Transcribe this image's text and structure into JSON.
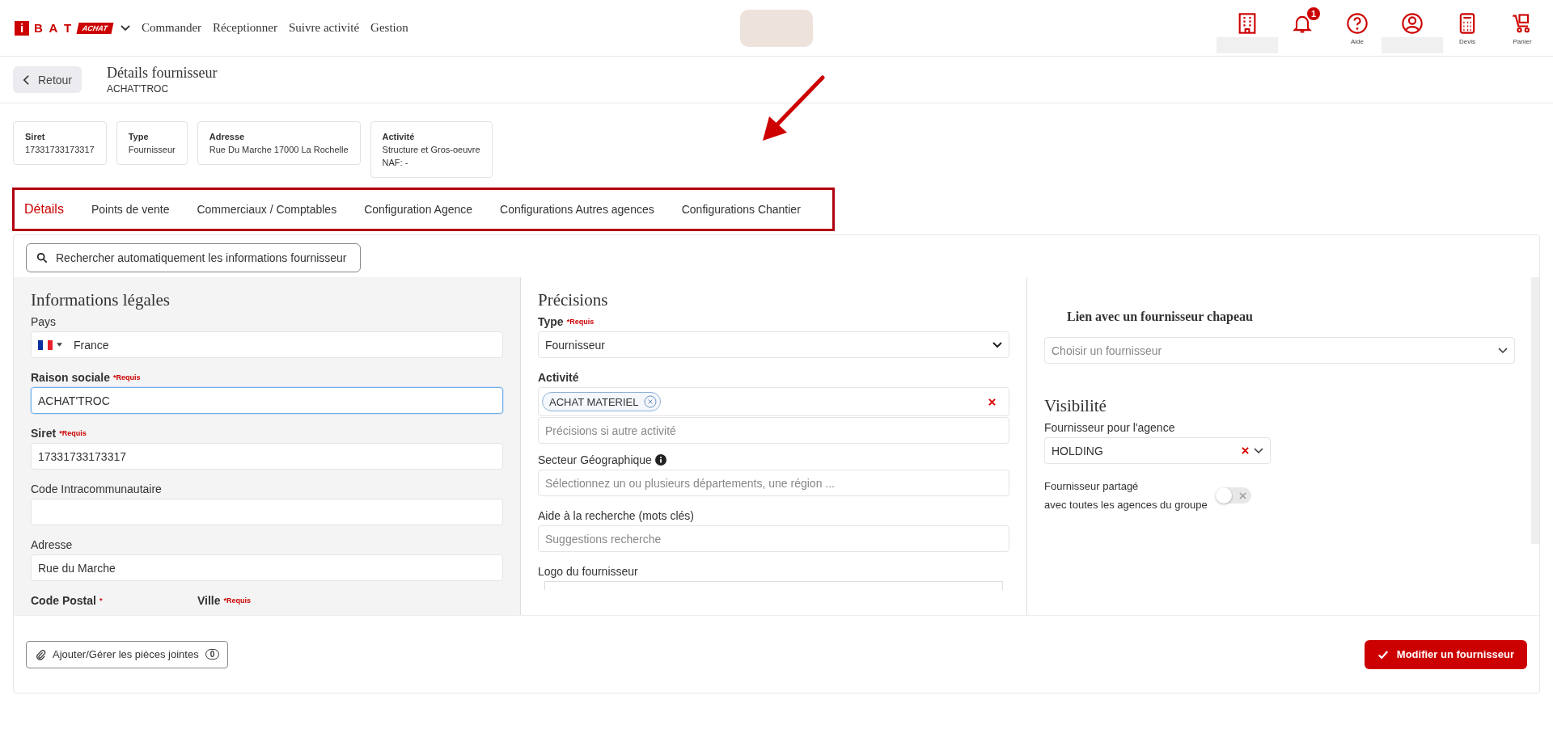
{
  "header": {
    "logo": {
      "mark": "i",
      "brand": "B A T",
      "tag": "ACHAT"
    },
    "nav": [
      "Commander",
      "Réceptionner",
      "Suivre activité",
      "Gestion"
    ],
    "icons": [
      {
        "kind": "building"
      },
      {
        "kind": "bell",
        "badge": "1"
      },
      {
        "kind": "help",
        "label": "Aide"
      },
      {
        "kind": "user"
      },
      {
        "kind": "calculator",
        "label": "Devis"
      },
      {
        "kind": "cart",
        "label": "Panier"
      }
    ]
  },
  "subheader": {
    "back": "Retour",
    "title": "Détails fournisseur",
    "subtitle": "ACHAT'TROC"
  },
  "info_cards": [
    {
      "label": "Siret",
      "lines": [
        "17331733173317"
      ]
    },
    {
      "label": "Type",
      "lines": [
        "Fournisseur"
      ]
    },
    {
      "label": "Adresse",
      "lines": [
        "Rue Du Marche 17000 La Rochelle"
      ]
    },
    {
      "label": "Activité",
      "lines": [
        "Structure et Gros-oeuvre",
        "NAF: -"
      ]
    }
  ],
  "tabs": [
    {
      "label": "Détails",
      "selected": true
    },
    {
      "label": "Points de vente",
      "selected": false
    },
    {
      "label": "Commerciaux / Comptables",
      "selected": false
    },
    {
      "label": "Configuration Agence",
      "selected": false
    },
    {
      "label": "Configurations Autres agences",
      "selected": false
    },
    {
      "label": "Configurations Chantier",
      "selected": false
    }
  ],
  "search_button": "Rechercher automatiquement les informations fournisseur",
  "legal": {
    "title": "Informations légales",
    "fields": [
      {
        "kind": "country",
        "label": "Pays",
        "value": "France"
      },
      {
        "kind": "text",
        "label": "Raison sociale",
        "required": "*Requis",
        "value": "ACHAT'TROC",
        "focused": true
      },
      {
        "kind": "text",
        "label": "Siret",
        "required": "*Requis",
        "value": "17331733173317",
        "focused": false
      },
      {
        "kind": "text",
        "label": "Code Intracommunautaire",
        "focused": false
      },
      {
        "kind": "text",
        "label": "Adresse",
        "value": "Rue du Marche",
        "focused": false
      },
      {
        "kind": "pair",
        "items": [
          {
            "label": "Code Postal",
            "required": "*"
          },
          {
            "label": "Ville",
            "required": "*Requis"
          }
        ]
      }
    ]
  },
  "details": {
    "title": "Précisions",
    "fields": [
      {
        "kind": "select",
        "label": "Type",
        "required": "*Requis",
        "value": "Fournisseur"
      },
      {
        "kind": "tags",
        "label": "Activité",
        "tags": [
          "ACHAT MATERIEL"
        ],
        "placeholder": "Précisions si autre activité"
      },
      {
        "kind": "text",
        "label": "Secteur Géographique",
        "info": true,
        "placeholder": "Sélectionnez un ou plusieurs départements, une région ...",
        "focused": false
      },
      {
        "kind": "text",
        "label": "Aide à la recherche (mots clés)",
        "placeholder": "Suggestions recherche",
        "focused": false
      },
      {
        "kind": "upload",
        "label": "Logo du fournisseur"
      }
    ]
  },
  "parent_link": {
    "title": "Lien avec un fournisseur chapeau",
    "placeholder": "Choisir un fournisseur"
  },
  "visibility": {
    "title": "Visibilité",
    "agency_label": "Fournisseur pour l'agence",
    "agency_value": "HOLDING",
    "shared_lines": [
      "Fournisseur partagé",
      "avec toutes les agences du groupe"
    ],
    "shared_on": false
  },
  "footer": {
    "attach": "Ajouter/Gérer les pièces jointes",
    "attach_count": "0",
    "submit": "Modifier un fournisseur"
  }
}
